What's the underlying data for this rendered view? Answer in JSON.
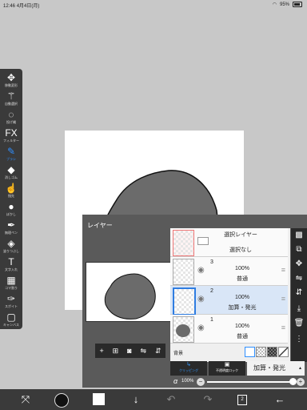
{
  "status_bar": {
    "time": "12:46",
    "date": "4月4日(月)",
    "battery": "95%"
  },
  "toolbar": {
    "items": [
      {
        "label": "移動変形",
        "icon": "move-icon",
        "glyph": "✥"
      },
      {
        "label": "自動選択",
        "icon": "magic-wand-icon",
        "glyph": "⚚"
      },
      {
        "label": "投げ縄",
        "icon": "lasso-icon",
        "glyph": "◌"
      },
      {
        "label": "フィルター",
        "icon": "filter-icon",
        "glyph": "FX"
      },
      {
        "label": "ブラシ",
        "icon": "brush-icon",
        "glyph": "✎"
      },
      {
        "label": "消しゴム",
        "icon": "eraser-icon",
        "glyph": "◆"
      },
      {
        "label": "指先",
        "icon": "smudge-icon",
        "glyph": "☝"
      },
      {
        "label": "ぼかし",
        "icon": "blur-icon",
        "glyph": "●"
      },
      {
        "label": "無理ペン",
        "icon": "correction-pen-icon",
        "glyph": "✒"
      },
      {
        "label": "塗りつぶし",
        "icon": "fill-icon",
        "glyph": "◈"
      },
      {
        "label": "文字入れ",
        "icon": "text-icon",
        "glyph": "T"
      },
      {
        "label": "コマ割り",
        "icon": "frame-divider-icon",
        "glyph": "▦"
      },
      {
        "label": "スポイト",
        "icon": "eyedropper-icon",
        "glyph": "✑"
      },
      {
        "label": "キャンバス",
        "icon": "canvas-icon",
        "glyph": "▢"
      }
    ],
    "active_index": 4
  },
  "layer_panel": {
    "title": "レイヤー",
    "selection_layer": {
      "title": "選択レイヤー",
      "subtitle": "選択なし"
    },
    "layers": [
      {
        "number": "3",
        "opacity": "100%",
        "mode": "普通",
        "selected": false
      },
      {
        "number": "2",
        "opacity": "100%",
        "mode": "加算・発光",
        "selected": true
      },
      {
        "number": "1",
        "opacity": "100%",
        "mode": "普通",
        "selected": false
      }
    ],
    "background_label": "背景",
    "clipping_label": "クリッピング",
    "lock_label": "不透明度ロック",
    "blend_mode": "加算・発光",
    "alpha_symbol": "α",
    "alpha_value": "100%",
    "alpha_fraction": 1.0
  },
  "bottom_bar": {
    "page_count": "2"
  },
  "colors": {
    "accent": "#2f8fff",
    "shape": "#6b6b6b",
    "panel": "#5a5a5a"
  }
}
